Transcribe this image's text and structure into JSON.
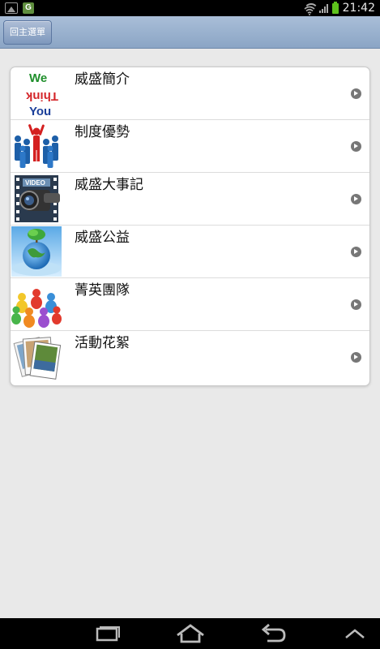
{
  "status_bar": {
    "time": "21:42",
    "notification_icons": [
      "image-icon",
      "g-app-icon"
    ],
    "g_app_letter": "G",
    "system_icons": [
      "wifi-icon",
      "signal-icon",
      "battery-icon"
    ],
    "battery_color": "#5ec21c"
  },
  "header": {
    "back_label": "回主選單"
  },
  "menu": {
    "items": [
      {
        "label": "威盛簡介",
        "icon": "we-think-you-icon",
        "logo_text": [
          "We",
          "Think",
          "You"
        ]
      },
      {
        "label": "制度優勢",
        "icon": "people-leader-icon"
      },
      {
        "label": "威盛大事記",
        "icon": "video-camera-icon",
        "logo_text": [
          "VIDEO"
        ]
      },
      {
        "label": "威盛公益",
        "icon": "globe-tree-icon"
      },
      {
        "label": "菁英團隊",
        "icon": "team-group-icon"
      },
      {
        "label": "活動花絮",
        "icon": "photo-album-icon"
      }
    ]
  },
  "nav_bar": {
    "buttons": [
      "recent-apps-icon",
      "home-icon",
      "back-icon",
      "menu-up-icon"
    ]
  }
}
